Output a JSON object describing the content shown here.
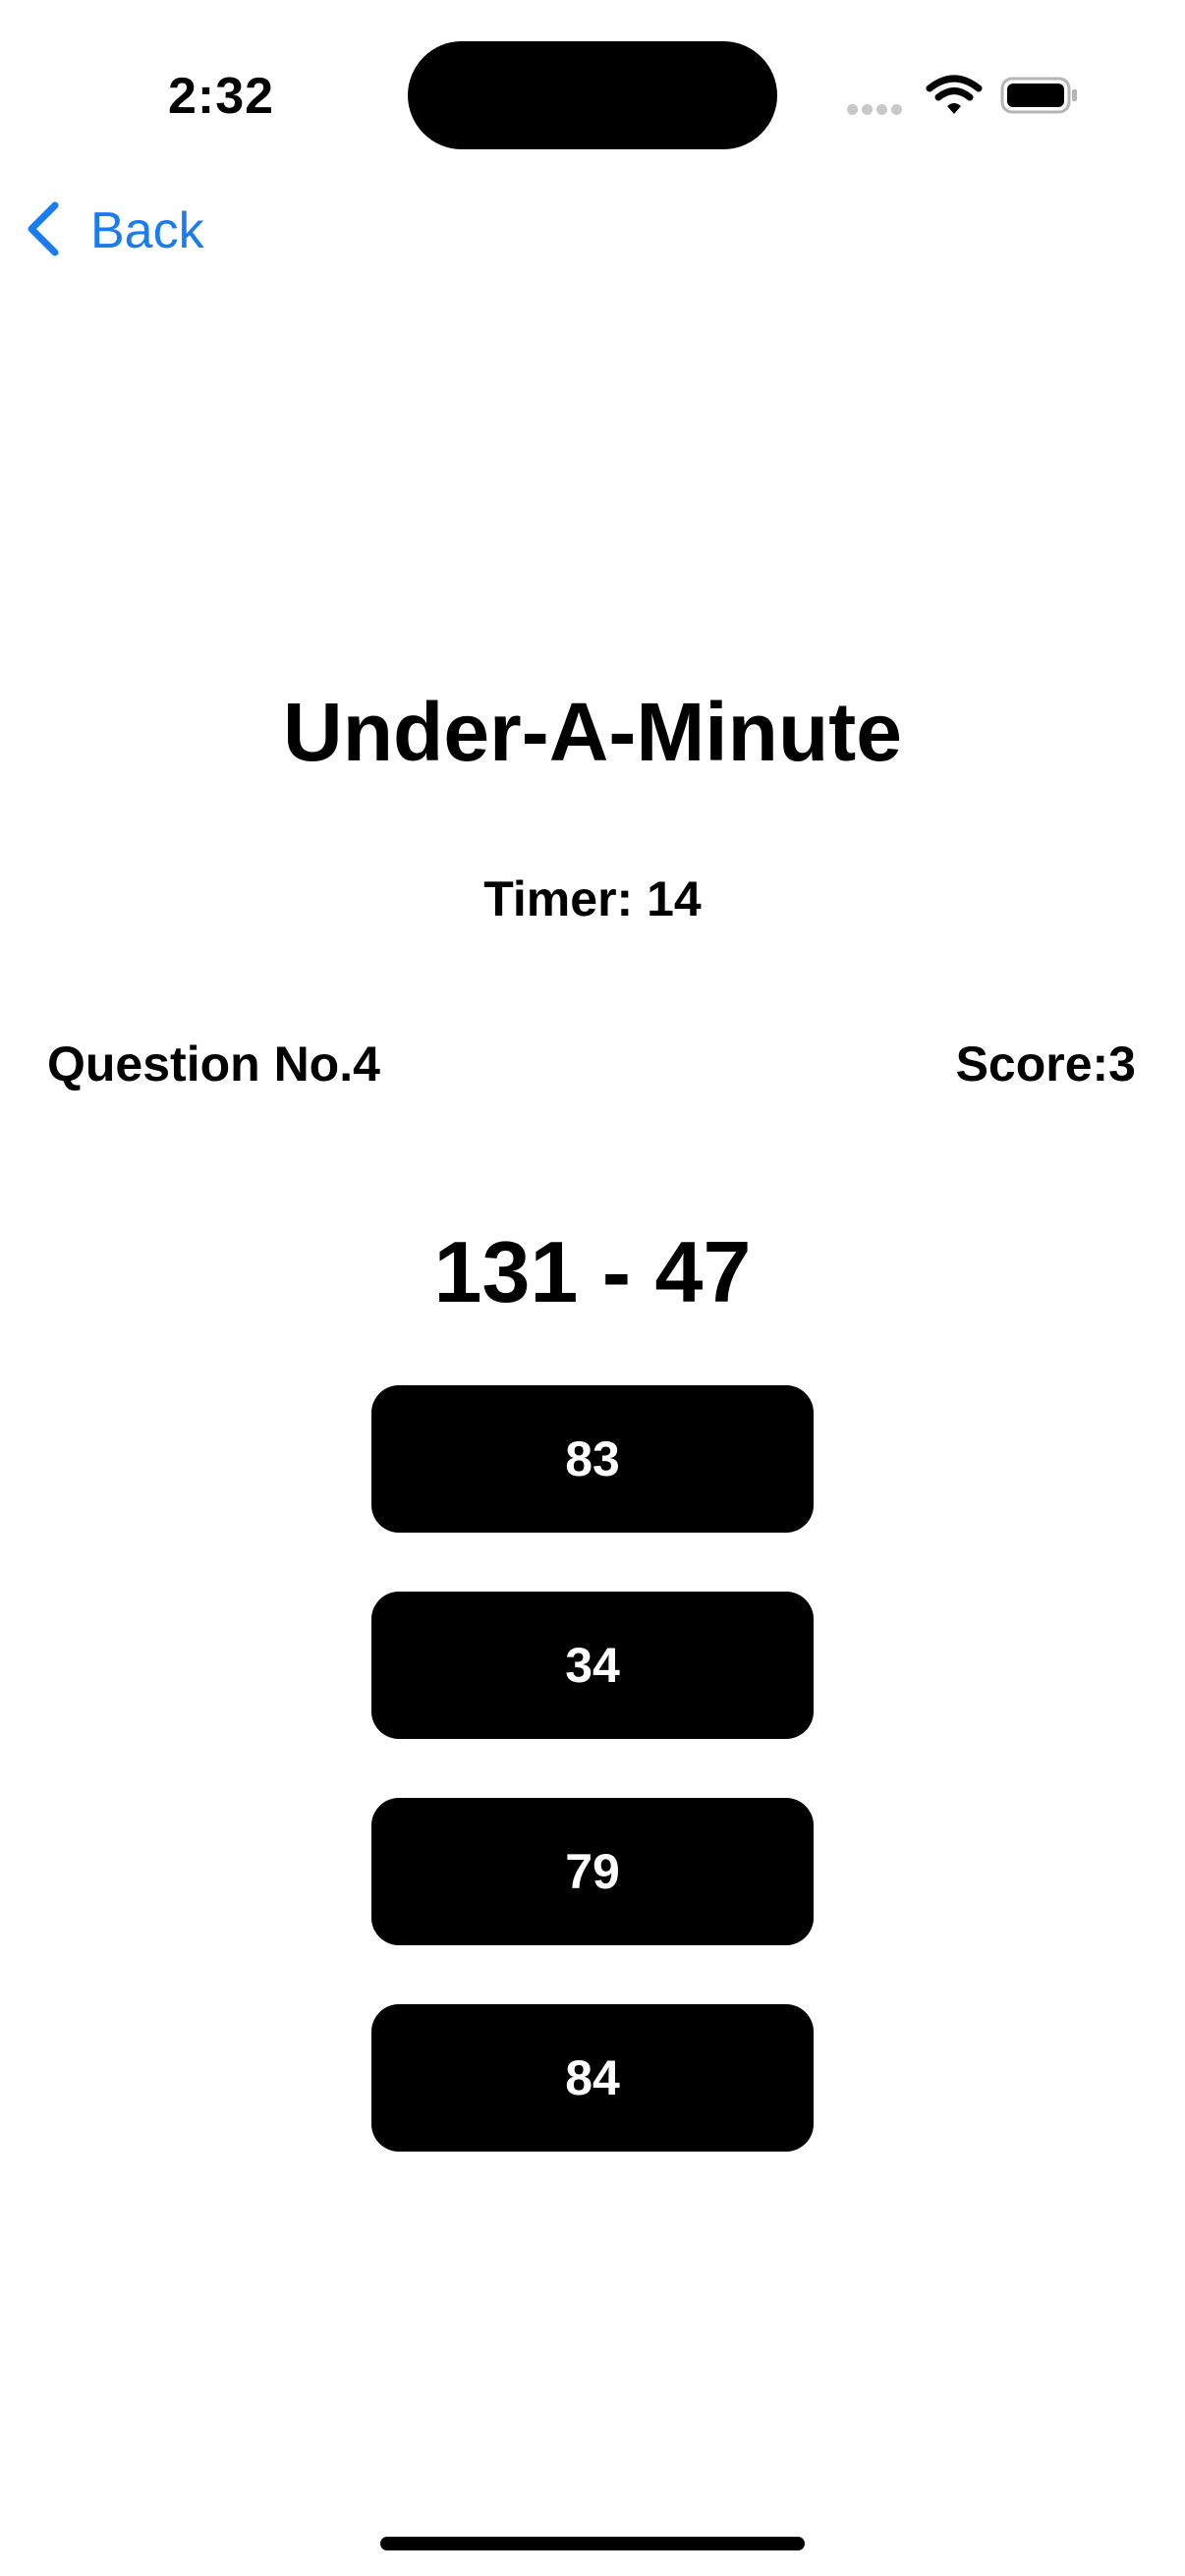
{
  "status_bar": {
    "time": "2:32",
    "icons": [
      "cellular-signal-icon",
      "wifi-icon",
      "battery-icon"
    ]
  },
  "nav": {
    "back_label": "Back",
    "back_icon": "chevron-left-icon",
    "accent_color": "#1a7cf0"
  },
  "game": {
    "title": "Under-A-Minute",
    "timer": "Timer: 14",
    "question_no": "Question No.4",
    "score": "Score:3",
    "problem": "131 - 47",
    "answers": [
      "83",
      "34",
      "79",
      "84"
    ]
  }
}
